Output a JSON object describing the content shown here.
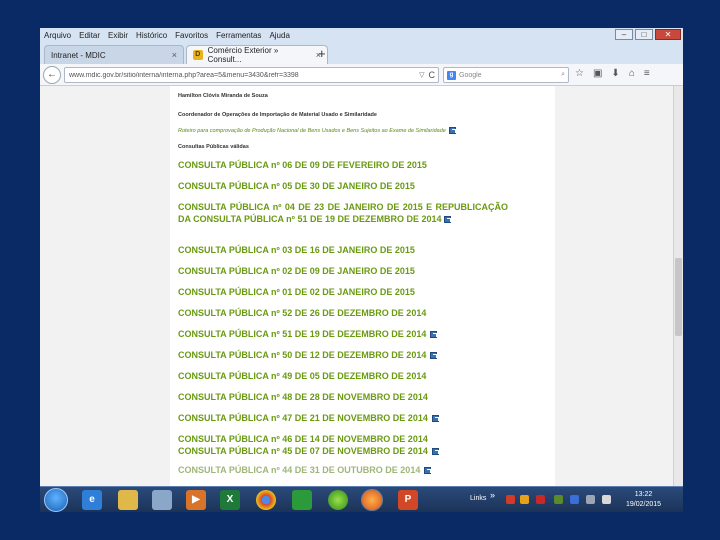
{
  "menu": [
    "Arquivo",
    "Editar",
    "Exibir",
    "Histórico",
    "Favoritos",
    "Ferramentas",
    "Ajuda"
  ],
  "window_controls": {
    "minimize": "–",
    "maximize": "□",
    "close": "✕"
  },
  "tabs": [
    {
      "label": "Intranet - MDIC",
      "close": "×"
    },
    {
      "label": "Comércio Exterior » Consult...",
      "close": "×",
      "favicon": "D"
    }
  ],
  "new_tab": "+",
  "nav": {
    "back": "←",
    "url": "www.mdic.gov.br/sitio/interna/interna.php?area=5&menu=3430&refr=3398",
    "url_dropdown": "▽",
    "reload": "C",
    "search_engine_icon": "g",
    "search_placeholder": "Google",
    "search_icon": "⌕",
    "tools": [
      "☆",
      "▣",
      "⬇",
      "⌂",
      "≡"
    ]
  },
  "page": {
    "author": "Hamilton Clóvis Miranda de Souza",
    "department": "Coordenador de Operações de Importação de Material Usado e Similaridade",
    "roteiro": "Roteiro para comprovação de Produção Nacional de Bens Usados e Bens Sujeitos ao Exame de Similaridade",
    "valid_heading": "Consultas Públicas válidas",
    "consultas": [
      {
        "text": "CONSULTA PÚBLICA nº 06 DE 09 DE FEVEREIRO DE 2015",
        "ext": false
      },
      {
        "text": "CONSULTA PÚBLICA nº 05 DE 30 DE JANEIRO DE 2015",
        "ext": false
      },
      {
        "text": "CONSULTA PÚBLICA nº 04 DE 23 DE JANEIRO DE 2015 E REPUBLICAÇÃO DA CONSULTA PÚBLICA nº 51 DE 19 DE DEZEMBRO DE 2014",
        "ext": true
      },
      {
        "text": "CONSULTA PÚBLICA nº 03 DE 16 DE JANEIRO DE 2015",
        "ext": false
      },
      {
        "text": "CONSULTA PÚBLICA nº 02 DE 09 DE JANEIRO DE 2015",
        "ext": false
      },
      {
        "text": "CONSULTA PÚBLICA nº 01 DE 02 DE JANEIRO DE 2015",
        "ext": false
      },
      {
        "text": "CONSULTA PÚBLICA nº 52 DE 26 DE DEZEMBRO DE 2014",
        "ext": false
      },
      {
        "text": "CONSULTA PÚBLICA nº 51 DE 19 DE DEZEMBRO DE 2014",
        "ext": true
      },
      {
        "text": "CONSULTA PÚBLICA nº 50 DE 12 DE DEZEMBRO DE 2014",
        "ext": true
      },
      {
        "text": "CONSULTA PÚBLICA nº 49 DE 05 DE DEZEMBRO DE 2014",
        "ext": false
      },
      {
        "text": "CONSULTA PÚBLICA nº 48 DE 28 DE NOVEMBRO DE 2014",
        "ext": false
      },
      {
        "text": "CONSULTA PÚBLICA nº 47 DE 21 DE NOVEMBRO DE 2014",
        "ext": true
      },
      {
        "text": "CONSULTA PÚBLICA nº 46 DE 14 DE NOVEMBRO DE 2014",
        "ext": false
      },
      {
        "text": "CONSULTA PÚBLICA nº 45 DE 07 DE NOVEMBRO DE 2014",
        "ext": true
      },
      {
        "text": "CONSULTA PÚBLICA nº 44 DE 31 DE OUTUBRO DE 2014",
        "ext": true
      }
    ]
  },
  "taskbar": {
    "apps": [
      "ie-icon",
      "explorer-icon",
      "calc-icon",
      "media-icon",
      "excel-icon",
      "chrome-icon",
      "brazil-flag-icon",
      "green-ball-icon",
      "firefox-icon",
      "powerpoint-icon"
    ],
    "links_label": "Links",
    "links_chevron": "»",
    "time": "13:22",
    "date": "19/02/2015"
  },
  "colors": {
    "link_green": "#6a9a12",
    "desktop": "#0a2a66",
    "taskbar": "#1b3358"
  }
}
